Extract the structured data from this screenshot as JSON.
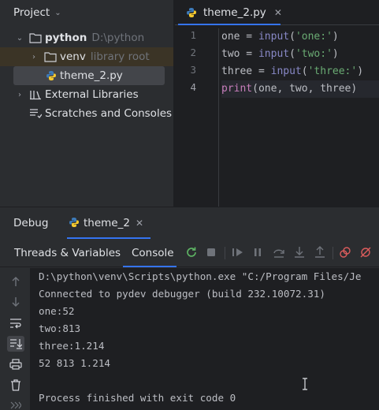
{
  "project_panel": {
    "title": "Project",
    "tree": [
      {
        "label": "python",
        "hint": "D:\\python"
      },
      {
        "label": "venv",
        "hint": "library root"
      },
      {
        "label": "theme_2.py",
        "hint": ""
      },
      {
        "label": "External Libraries",
        "hint": ""
      },
      {
        "label": "Scratches and Consoles",
        "hint": ""
      }
    ]
  },
  "editor": {
    "tab_label": "theme_2.py",
    "line_numbers": [
      "1",
      "2",
      "3",
      "4"
    ],
    "lines": [
      {
        "var": "one",
        "op": " = ",
        "fn": "input",
        "open": "(",
        "str": "'one:'",
        "close": ")"
      },
      {
        "var": "two",
        "op": " = ",
        "fn": "input",
        "open": "(",
        "str": "'two:'",
        "close": ")"
      },
      {
        "var": "three",
        "op": " = ",
        "fn": "input",
        "open": "(",
        "str": "'three:'",
        "close": ")"
      }
    ],
    "print_line": {
      "fn": "print",
      "args": "(one, two, three)"
    }
  },
  "debug": {
    "title": "Debug",
    "session_tab": "theme_2",
    "sub_tabs": [
      "Threads & Variables",
      "Console"
    ],
    "console_lines": [
      "D:\\python\\venv\\Scripts\\python.exe \"C:/Program Files/Je",
      "Connected to pydev debugger (build 232.10072.31)",
      "one:52",
      "two:813",
      "three:1.214",
      "52 813 1.214",
      "",
      "Process finished with exit code 0"
    ]
  },
  "colors": {
    "accent": "#3574f0",
    "panel_bg": "#2b2d30",
    "editor_bg": "#1e1f22",
    "rerun_green": "#5fb865",
    "stop_red": "#db5c5c"
  }
}
